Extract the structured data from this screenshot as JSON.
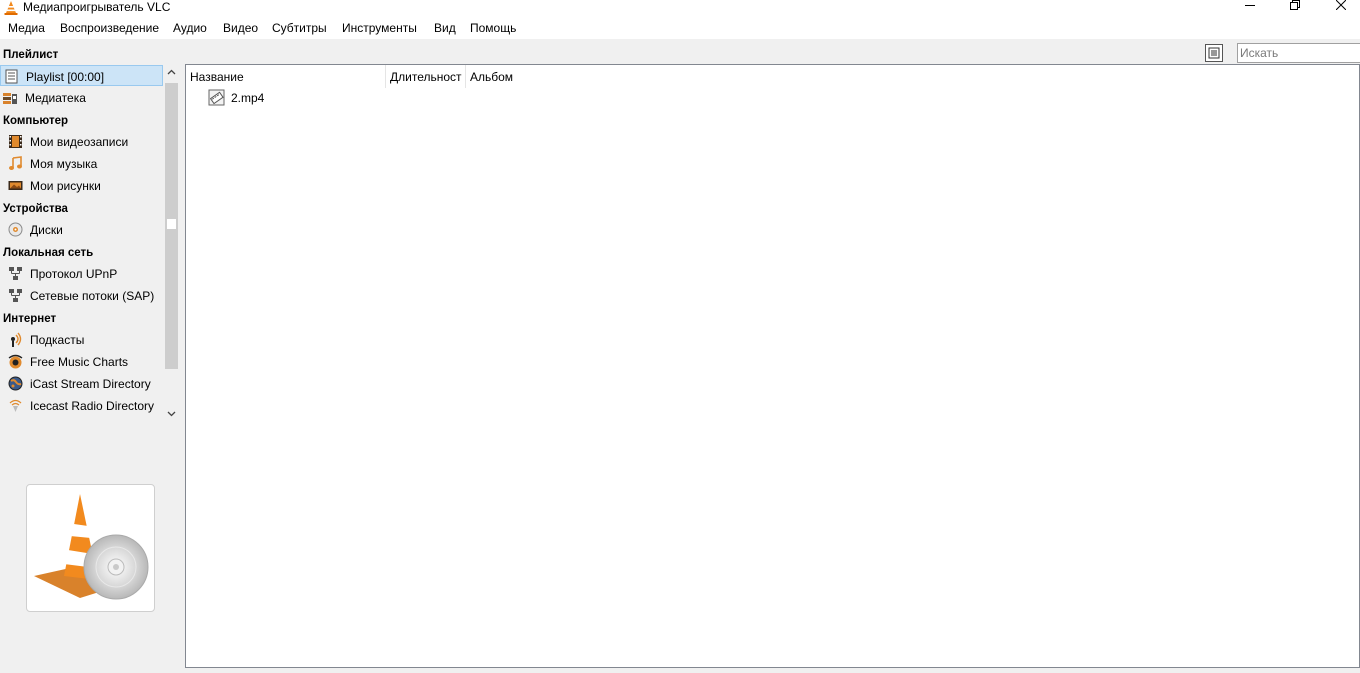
{
  "window": {
    "title": "Медиапроигрыватель VLC",
    "controls": [
      "minimize",
      "maximize",
      "close"
    ]
  },
  "menu": [
    "Медиа",
    "Воспроизведение",
    "Аудио",
    "Видео",
    "Субтитры",
    "Инструменты",
    "Вид",
    "Помощь"
  ],
  "sidebar": {
    "sections": {
      "playlist": "Плейлист",
      "computer": "Компьютер",
      "devices": "Устройства",
      "lan": "Локальная сеть",
      "internet": "Интернет"
    },
    "items": {
      "playlist": "Playlist [00:00]",
      "library": "Медиатека",
      "videos": "Мои видеозаписи",
      "music": "Моя музыка",
      "pictures": "Мои рисунки",
      "discs": "Диски",
      "upnp": "Протокол UPnP",
      "sap": "Сетевые потоки (SAP)",
      "podcasts": "Подкасты",
      "free_music": "Free Music Charts",
      "icast": "iCast Stream Directory",
      "icecast": "Icecast Radio Directory"
    },
    "selected": "playlist"
  },
  "toolbar": {
    "search_placeholder": "Искать"
  },
  "playlist": {
    "columns": [
      "Название",
      "Длительност",
      "Альбом"
    ],
    "rows": [
      {
        "title": "2.mp4",
        "duration": "",
        "album": ""
      }
    ]
  },
  "colors": {
    "selection": "#cce4f7",
    "selection_border": "#99c9ef",
    "vlc_orange": "#f28a1e"
  }
}
